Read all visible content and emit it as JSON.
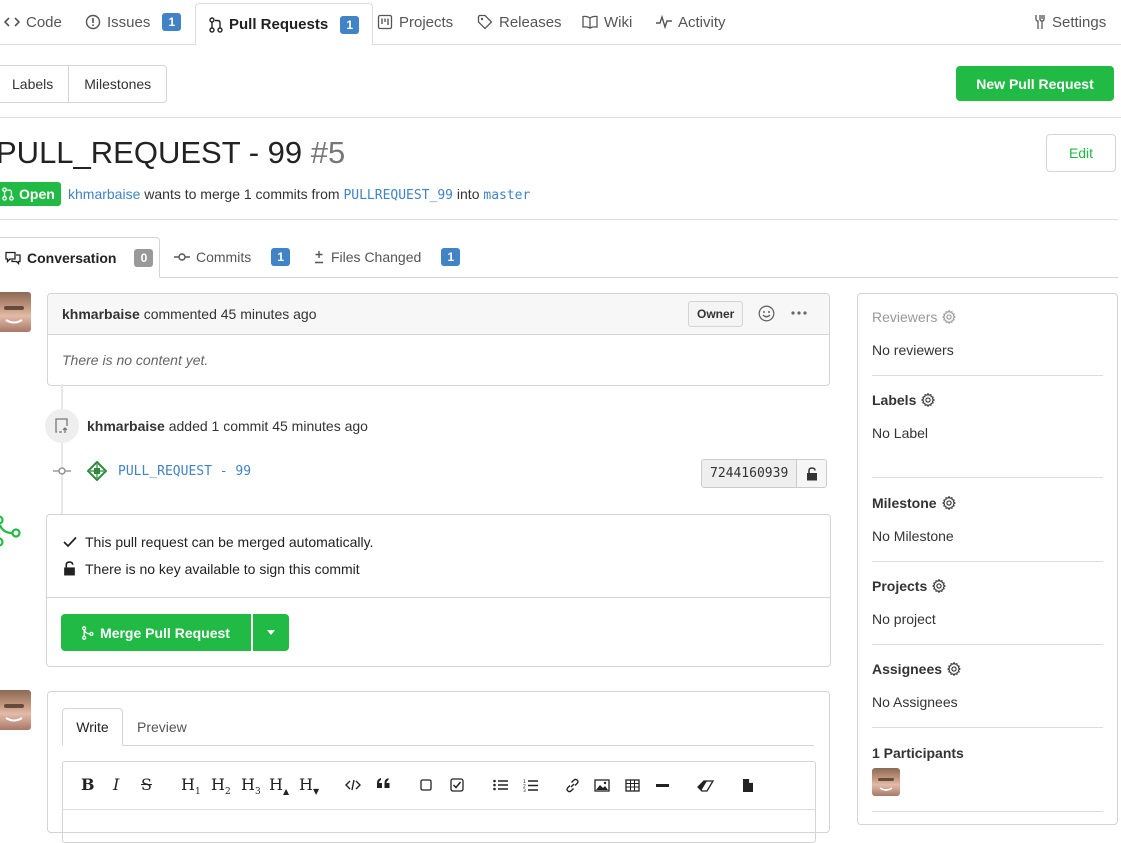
{
  "repo_tabs": {
    "code": "Code",
    "issues": "Issues",
    "issues_count": "1",
    "pull_requests": "Pull Requests",
    "pull_requests_count": "1",
    "projects": "Projects",
    "releases": "Releases",
    "wiki": "Wiki",
    "activity": "Activity",
    "settings": "Settings"
  },
  "filters": {
    "labels": "Labels",
    "milestones": "Milestones"
  },
  "new_pr_button": "New Pull Request",
  "pr": {
    "title": "PULL_REQUEST - 99",
    "number": "#5",
    "edit_button": "Edit",
    "status": "Open",
    "author": "khmarbaise",
    "merge_text_1": "wants to merge 1 commits from",
    "source_branch": "PULLREQUEST_99",
    "merge_text_2": "into",
    "target_branch": "master"
  },
  "pr_tabs": {
    "conversation": "Conversation",
    "conversation_count": "0",
    "commits": "Commits",
    "commits_count": "1",
    "files_changed": "Files Changed",
    "files_count": "1"
  },
  "comment": {
    "author": "khmarbaise",
    "action": "commented 45 minutes ago",
    "role": "Owner",
    "body": "There is no content yet."
  },
  "timeline": {
    "author": "khmarbaise",
    "event": "added 1 commit 45 minutes ago",
    "commit_message": "PULL_REQUEST - 99",
    "commit_sha": "7244160939"
  },
  "merge_box": {
    "auto_merge": "This pull request can be merged automatically.",
    "no_key": "There is no key available to sign this commit",
    "merge_button": "Merge Pull Request"
  },
  "editor": {
    "write_tab": "Write",
    "preview_tab": "Preview",
    "toolbar": [
      "B",
      "I",
      "S",
      "H1",
      "H2",
      "H3",
      "H▲",
      "H▼",
      "code",
      "quote",
      "checkbox-empty",
      "checkbox-checked",
      "bullet-list",
      "ordered-list",
      "link",
      "image",
      "table",
      "hr",
      "eraser",
      "file"
    ]
  },
  "sidebar": {
    "reviewers_label": "Reviewers",
    "reviewers_value": "No reviewers",
    "labels_label": "Labels",
    "labels_value": "No Label",
    "milestone_label": "Milestone",
    "milestone_value": "No Milestone",
    "projects_label": "Projects",
    "projects_value": "No project",
    "assignees_label": "Assignees",
    "assignees_value": "No Assignees",
    "participants_label": "1 Participants"
  },
  "colors": {
    "green": "#21ba45",
    "blue_badge": "#4183c4",
    "link_blue": "#4183c4",
    "border": "#d4d4d5"
  }
}
